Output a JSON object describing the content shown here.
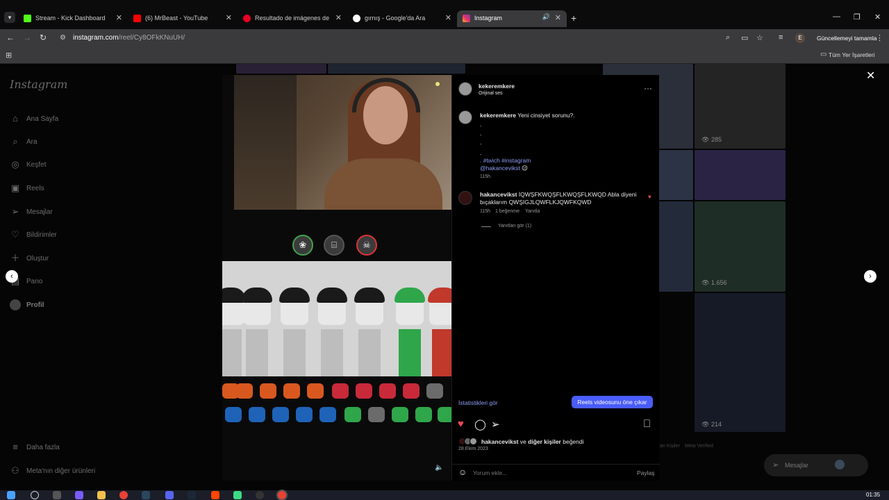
{
  "browser": {
    "tabs": [
      {
        "title": "Stream - Kick Dashboard",
        "favicon_color": "#53fc18"
      },
      {
        "title": "(6) MrBeast - YouTube",
        "favicon_color": "#ff0000"
      },
      {
        "title": "Resultado de imágenes de Goo",
        "favicon_color": "#e60023"
      },
      {
        "title": "gırnış - Google'da Ara",
        "favicon_color": "#ffffff"
      },
      {
        "title": "Instagram",
        "favicon_color": "#e1306c"
      }
    ],
    "url_host": "instagram.com",
    "url_path": "/reel/Cy8OFkKNuUH/",
    "profile_initial": "E",
    "update_label": "Güncellemeyi tamamla",
    "all_bookmarks_label": "Tüm Yer İşaretleri"
  },
  "instagram": {
    "logo": "Instagram",
    "nav": [
      {
        "label": "Ana Sayfa",
        "icon": "home-icon"
      },
      {
        "label": "Ara",
        "icon": "search-icon"
      },
      {
        "label": "Keşfet",
        "icon": "explore-icon"
      },
      {
        "label": "Reels",
        "icon": "reels-icon"
      },
      {
        "label": "Mesajlar",
        "icon": "messages-icon"
      },
      {
        "label": "Bildirimler",
        "icon": "heart-icon"
      },
      {
        "label": "Oluştur",
        "icon": "plus-icon"
      },
      {
        "label": "Pano",
        "icon": "dashboard-icon"
      },
      {
        "label": "Profil",
        "icon": "avatar"
      }
    ],
    "more": "Daha fazla",
    "meta_more": "Meta'nın diğer ürünleri",
    "grid_counts": [
      "285",
      "1.656",
      "214"
    ],
    "footer_bits": [
      "an Kişiler",
      "Meta Verified"
    ],
    "messages_pill": "Mesajlar"
  },
  "post": {
    "username": "kekeremkere",
    "audio": "Orijinal ses",
    "caption_user": "kekeremkere",
    "caption": "Yeni cinsiyet sorunu?.",
    "caption_dots": [
      ".",
      ".",
      ".",
      "."
    ],
    "hashtags": ". #twich #instagram",
    "mention": "@hakancevikst",
    "mention_emoji": "😉",
    "caption_time": "115h",
    "comment": {
      "user": "hakancevikst",
      "text": "İQWŞFKWQŞFLKWQŞFLKWQD Abla diyeni bıçaklarım QWŞIGJLQWFLKJQWFKQWD",
      "time": "115h",
      "likes": "1 beğenme",
      "reply": "Yanıtla",
      "view_replies": "Yanıtları gör (1)"
    },
    "insights_label": "İstatistikleri gör",
    "boost_label": "Reels videosunu öne çıkar",
    "liked_by_user": "hakancevikst",
    "liked_by_rest": "ve",
    "liked_by_others": "diğer kişiler",
    "liked_by_suffix": "beğendi",
    "date": "28 Ekim 2023",
    "comment_placeholder": "Yorum ekle...",
    "share_label": "Paylaş"
  },
  "system": {
    "clock": "01:35"
  },
  "colors": {
    "accent_blue": "#4a5df9",
    "like_red": "#ed4956",
    "link_blue": "#8c9ef5"
  }
}
